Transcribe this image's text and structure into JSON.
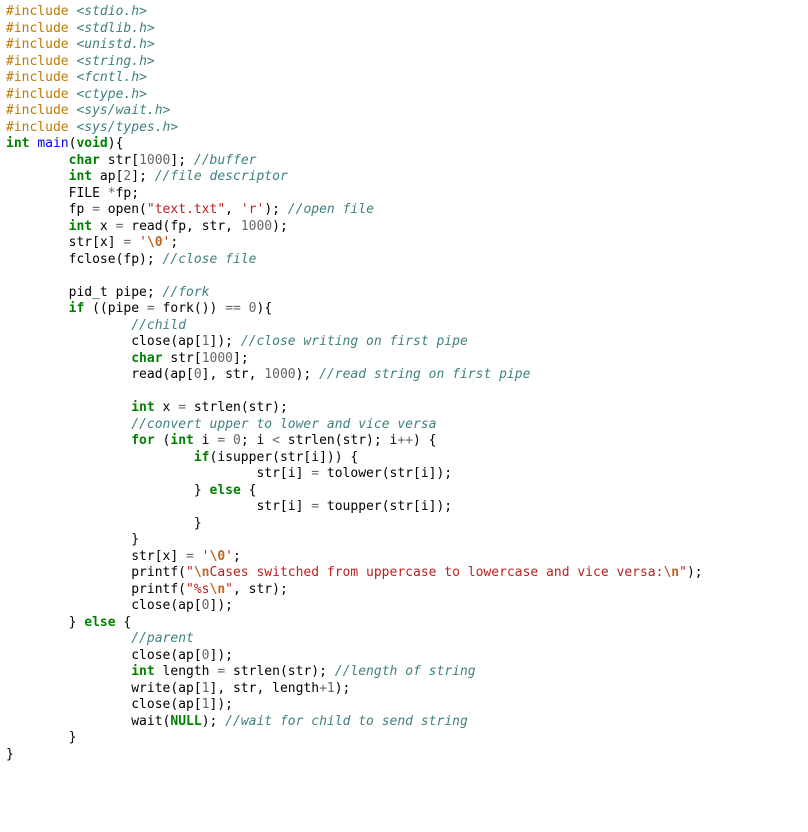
{
  "language": "c",
  "tokens": [
    [
      {
        "c": "pp",
        "t": "#include "
      },
      {
        "c": "inc",
        "t": "<stdio.h>"
      }
    ],
    [
      {
        "c": "pp",
        "t": "#include "
      },
      {
        "c": "inc",
        "t": "<stdlib.h>"
      }
    ],
    [
      {
        "c": "pp",
        "t": "#include "
      },
      {
        "c": "inc",
        "t": "<unistd.h>"
      }
    ],
    [
      {
        "c": "pp",
        "t": "#include "
      },
      {
        "c": "inc",
        "t": "<string.h>"
      }
    ],
    [
      {
        "c": "pp",
        "t": "#include "
      },
      {
        "c": "inc",
        "t": "<fcntl.h>"
      }
    ],
    [
      {
        "c": "pp",
        "t": "#include "
      },
      {
        "c": "inc",
        "t": "<ctype.h>"
      }
    ],
    [
      {
        "c": "pp",
        "t": "#include "
      },
      {
        "c": "inc",
        "t": "<sys/wait.h>"
      }
    ],
    [
      {
        "c": "pp",
        "t": "#include "
      },
      {
        "c": "inc",
        "t": "<sys/types.h>"
      }
    ],
    [
      {
        "c": "kw",
        "t": "int"
      },
      {
        "c": "nm",
        "t": " "
      },
      {
        "c": "fn",
        "t": "main"
      },
      {
        "c": "nm",
        "t": "("
      },
      {
        "c": "kw",
        "t": "void"
      },
      {
        "c": "nm",
        "t": "){"
      }
    ],
    [
      {
        "c": "nm",
        "t": "        "
      },
      {
        "c": "kw",
        "t": "char"
      },
      {
        "c": "nm",
        "t": " str["
      },
      {
        "c": "num",
        "t": "1000"
      },
      {
        "c": "nm",
        "t": "]; "
      },
      {
        "c": "cmt",
        "t": "//buffer"
      }
    ],
    [
      {
        "c": "nm",
        "t": "        "
      },
      {
        "c": "kw",
        "t": "int"
      },
      {
        "c": "nm",
        "t": " ap["
      },
      {
        "c": "num",
        "t": "2"
      },
      {
        "c": "nm",
        "t": "]; "
      },
      {
        "c": "cmt",
        "t": "//file descriptor"
      }
    ],
    [
      {
        "c": "nm",
        "t": "        FILE "
      },
      {
        "c": "op",
        "t": "*"
      },
      {
        "c": "nm",
        "t": "fp;"
      }
    ],
    [
      {
        "c": "nm",
        "t": "        fp "
      },
      {
        "c": "op",
        "t": "="
      },
      {
        "c": "nm",
        "t": " open("
      },
      {
        "c": "str",
        "t": "\"text.txt\""
      },
      {
        "c": "nm",
        "t": ", "
      },
      {
        "c": "chr",
        "t": "'r'"
      },
      {
        "c": "nm",
        "t": "); "
      },
      {
        "c": "cmt",
        "t": "//open file"
      }
    ],
    [
      {
        "c": "nm",
        "t": "        "
      },
      {
        "c": "kw",
        "t": "int"
      },
      {
        "c": "nm",
        "t": " x "
      },
      {
        "c": "op",
        "t": "="
      },
      {
        "c": "nm",
        "t": " read(fp, str, "
      },
      {
        "c": "num",
        "t": "1000"
      },
      {
        "c": "nm",
        "t": ");"
      }
    ],
    [
      {
        "c": "nm",
        "t": "        str[x] "
      },
      {
        "c": "op",
        "t": "="
      },
      {
        "c": "nm",
        "t": " "
      },
      {
        "c": "chr",
        "t": "'"
      },
      {
        "c": "esc",
        "t": "\\0"
      },
      {
        "c": "chr",
        "t": "'"
      },
      {
        "c": "nm",
        "t": ";"
      }
    ],
    [
      {
        "c": "nm",
        "t": "        fclose(fp); "
      },
      {
        "c": "cmt",
        "t": "//close file"
      }
    ],
    [
      {
        "c": "nm",
        "t": ""
      }
    ],
    [
      {
        "c": "nm",
        "t": "        pid_t pipe; "
      },
      {
        "c": "cmt",
        "t": "//fork"
      }
    ],
    [
      {
        "c": "nm",
        "t": "        "
      },
      {
        "c": "kw",
        "t": "if"
      },
      {
        "c": "nm",
        "t": " ((pipe "
      },
      {
        "c": "op",
        "t": "="
      },
      {
        "c": "nm",
        "t": " fork()) "
      },
      {
        "c": "op",
        "t": "=="
      },
      {
        "c": "nm",
        "t": " "
      },
      {
        "c": "num",
        "t": "0"
      },
      {
        "c": "nm",
        "t": "){"
      }
    ],
    [
      {
        "c": "nm",
        "t": "                "
      },
      {
        "c": "cmt",
        "t": "//child"
      }
    ],
    [
      {
        "c": "nm",
        "t": "                close(ap["
      },
      {
        "c": "num",
        "t": "1"
      },
      {
        "c": "nm",
        "t": "]); "
      },
      {
        "c": "cmt",
        "t": "//close writing on first pipe"
      }
    ],
    [
      {
        "c": "nm",
        "t": "                "
      },
      {
        "c": "kw",
        "t": "char"
      },
      {
        "c": "nm",
        "t": " str["
      },
      {
        "c": "num",
        "t": "1000"
      },
      {
        "c": "nm",
        "t": "];"
      }
    ],
    [
      {
        "c": "nm",
        "t": "                read(ap["
      },
      {
        "c": "num",
        "t": "0"
      },
      {
        "c": "nm",
        "t": "], str, "
      },
      {
        "c": "num",
        "t": "1000"
      },
      {
        "c": "nm",
        "t": "); "
      },
      {
        "c": "cmt",
        "t": "//read string on first pipe"
      }
    ],
    [
      {
        "c": "nm",
        "t": ""
      }
    ],
    [
      {
        "c": "nm",
        "t": "                "
      },
      {
        "c": "kw",
        "t": "int"
      },
      {
        "c": "nm",
        "t": " x "
      },
      {
        "c": "op",
        "t": "="
      },
      {
        "c": "nm",
        "t": " strlen(str);"
      }
    ],
    [
      {
        "c": "nm",
        "t": "                "
      },
      {
        "c": "cmt",
        "t": "//convert upper to lower and vice versa"
      }
    ],
    [
      {
        "c": "nm",
        "t": "                "
      },
      {
        "c": "kw",
        "t": "for"
      },
      {
        "c": "nm",
        "t": " ("
      },
      {
        "c": "kw",
        "t": "int"
      },
      {
        "c": "nm",
        "t": " i "
      },
      {
        "c": "op",
        "t": "="
      },
      {
        "c": "nm",
        "t": " "
      },
      {
        "c": "num",
        "t": "0"
      },
      {
        "c": "nm",
        "t": "; i "
      },
      {
        "c": "op",
        "t": "<"
      },
      {
        "c": "nm",
        "t": " strlen(str); i"
      },
      {
        "c": "op",
        "t": "++"
      },
      {
        "c": "nm",
        "t": ") {"
      }
    ],
    [
      {
        "c": "nm",
        "t": "                        "
      },
      {
        "c": "kw",
        "t": "if"
      },
      {
        "c": "nm",
        "t": "(isupper(str[i])) {"
      }
    ],
    [
      {
        "c": "nm",
        "t": "                                str[i] "
      },
      {
        "c": "op",
        "t": "="
      },
      {
        "c": "nm",
        "t": " tolower(str[i]);"
      }
    ],
    [
      {
        "c": "nm",
        "t": "                        } "
      },
      {
        "c": "kw",
        "t": "else"
      },
      {
        "c": "nm",
        "t": " {"
      }
    ],
    [
      {
        "c": "nm",
        "t": "                                str[i] "
      },
      {
        "c": "op",
        "t": "="
      },
      {
        "c": "nm",
        "t": " toupper(str[i]);"
      }
    ],
    [
      {
        "c": "nm",
        "t": "                        }"
      }
    ],
    [
      {
        "c": "nm",
        "t": "                }"
      }
    ],
    [
      {
        "c": "nm",
        "t": "                str[x] "
      },
      {
        "c": "op",
        "t": "="
      },
      {
        "c": "nm",
        "t": " "
      },
      {
        "c": "chr",
        "t": "'"
      },
      {
        "c": "esc",
        "t": "\\0"
      },
      {
        "c": "chr",
        "t": "'"
      },
      {
        "c": "nm",
        "t": ";"
      }
    ],
    [
      {
        "c": "nm",
        "t": "                printf("
      },
      {
        "c": "str",
        "t": "\""
      },
      {
        "c": "esc",
        "t": "\\n"
      },
      {
        "c": "str",
        "t": "Cases switched from uppercase to lowercase and vice versa:"
      },
      {
        "c": "esc",
        "t": "\\n"
      },
      {
        "c": "str",
        "t": "\""
      },
      {
        "c": "nm",
        "t": ");"
      }
    ],
    [
      {
        "c": "nm",
        "t": "                printf("
      },
      {
        "c": "str",
        "t": "\"%s"
      },
      {
        "c": "esc",
        "t": "\\n"
      },
      {
        "c": "str",
        "t": "\""
      },
      {
        "c": "nm",
        "t": ", str);"
      }
    ],
    [
      {
        "c": "nm",
        "t": "                close(ap["
      },
      {
        "c": "num",
        "t": "0"
      },
      {
        "c": "nm",
        "t": "]);"
      }
    ],
    [
      {
        "c": "nm",
        "t": "        } "
      },
      {
        "c": "kw",
        "t": "else"
      },
      {
        "c": "nm",
        "t": " {"
      }
    ],
    [
      {
        "c": "nm",
        "t": "                "
      },
      {
        "c": "cmt",
        "t": "//parent"
      }
    ],
    [
      {
        "c": "nm",
        "t": "                close(ap["
      },
      {
        "c": "num",
        "t": "0"
      },
      {
        "c": "nm",
        "t": "]);"
      }
    ],
    [
      {
        "c": "nm",
        "t": "                "
      },
      {
        "c": "kw",
        "t": "int"
      },
      {
        "c": "nm",
        "t": " length "
      },
      {
        "c": "op",
        "t": "="
      },
      {
        "c": "nm",
        "t": " strlen(str); "
      },
      {
        "c": "cmt",
        "t": "//length of string"
      }
    ],
    [
      {
        "c": "nm",
        "t": "                write(ap["
      },
      {
        "c": "num",
        "t": "1"
      },
      {
        "c": "nm",
        "t": "], str, length"
      },
      {
        "c": "op",
        "t": "+"
      },
      {
        "c": "num",
        "t": "1"
      },
      {
        "c": "nm",
        "t": ");"
      }
    ],
    [
      {
        "c": "nm",
        "t": "                close(ap["
      },
      {
        "c": "num",
        "t": "1"
      },
      {
        "c": "nm",
        "t": "]);"
      }
    ],
    [
      {
        "c": "nm",
        "t": "                wait("
      },
      {
        "c": "kw",
        "t": "NULL"
      },
      {
        "c": "nm",
        "t": "); "
      },
      {
        "c": "cmt",
        "t": "//wait for child to send string"
      }
    ],
    [
      {
        "c": "nm",
        "t": "        }"
      }
    ],
    [
      {
        "c": "nm",
        "t": "}"
      }
    ]
  ]
}
